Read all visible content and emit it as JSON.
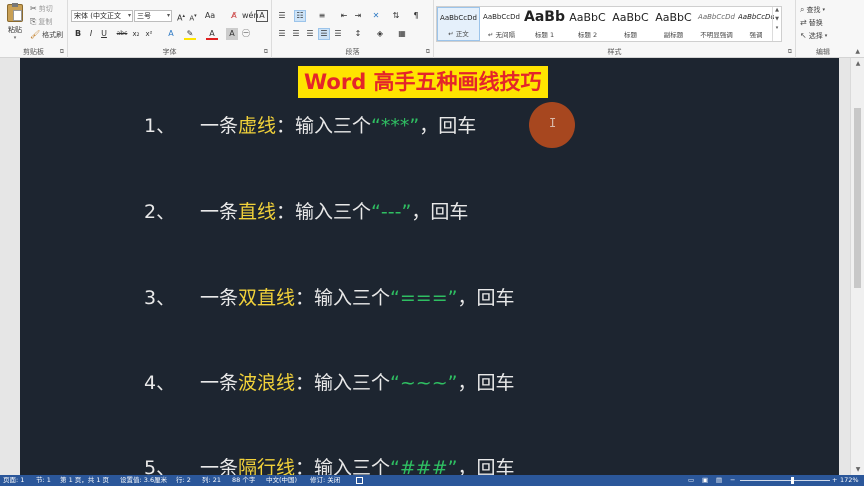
{
  "ribbon": {
    "clipboard": {
      "paste": "粘贴",
      "cut": "剪切",
      "copy": "复制",
      "format_painter": "格式刷",
      "group_label": "剪贴板"
    },
    "font": {
      "font_name": "宋体 (中文正文",
      "font_size": "三号",
      "group_label": "字体"
    },
    "paragraph": {
      "group_label": "段落"
    },
    "styles": {
      "group_label": "样式",
      "items": [
        {
          "preview": "AaBbCcDd",
          "name": "↵ 正文"
        },
        {
          "preview": "AaBbCcDd",
          "name": "↵ 无间隔"
        },
        {
          "preview": "AaBb",
          "name": "标题 1"
        },
        {
          "preview": "AaBbC",
          "name": "标题 2"
        },
        {
          "preview": "AaBbC",
          "name": "标题"
        },
        {
          "preview": "AaBbC",
          "name": "副标题"
        },
        {
          "preview": "AaBbCcDd",
          "name": "不明显强调"
        },
        {
          "preview": "AaBbCcDd",
          "name": "强调"
        }
      ]
    },
    "editing": {
      "find": "查找",
      "replace": "替换",
      "select": "选择",
      "group_label": "编辑"
    }
  },
  "document": {
    "title": "Word 高手五种画线技巧",
    "items": [
      {
        "num": "1、",
        "prefix": "一条",
        "hl": "虚线",
        "mid": "：输入三个",
        "sym": "“***”",
        "suffix": "，回车"
      },
      {
        "num": "2、",
        "prefix": "一条",
        "hl": "直线",
        "mid": "：输入三个",
        "sym": "“---”",
        "suffix": "，回车"
      },
      {
        "num": "3、",
        "prefix": "一条",
        "hl": "双直线",
        "mid": "：输入三个",
        "sym": "“===”",
        "suffix": "，回车"
      },
      {
        "num": "4、",
        "prefix": "一条",
        "hl": "波浪线",
        "mid": "：输入三个",
        "sym": "“~~~”",
        "suffix": "，回车"
      },
      {
        "num": "5、",
        "prefix": "一条",
        "hl": "隔行线",
        "mid": "：输入三个",
        "sym": "“###”",
        "suffix": "，回车"
      }
    ],
    "cursor_glyph": "I"
  },
  "status": {
    "page": "页面: 1",
    "section": "节: 1",
    "page_of": "第 1 页，共 1 页",
    "position": "设置值: 3.6厘米",
    "row": "行: 2",
    "col": "列: 21",
    "words": "88 个字",
    "language": "中文(中国)",
    "revisions": "修订: 关闭",
    "zoom": "172%"
  },
  "colors": {
    "page_bg": "#1d2530",
    "title_bg": "#ffe400",
    "title_fg": "#e4252a",
    "highlight": "#f2d23a",
    "symbol": "#2fbf62",
    "status_bg": "#2b579a"
  }
}
